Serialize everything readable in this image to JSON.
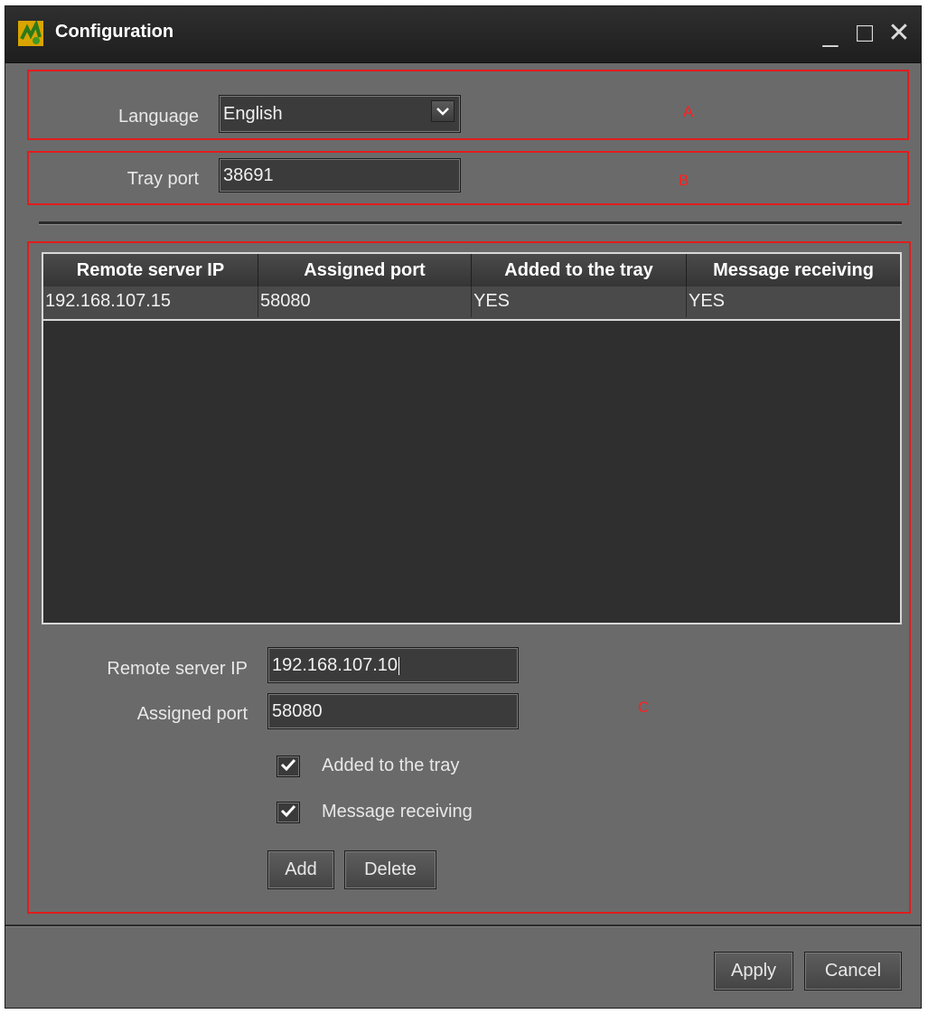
{
  "window": {
    "title": "Configuration",
    "controls": {
      "minimize": "_",
      "maximize": "□",
      "close": "✕"
    }
  },
  "section_a": {
    "zone_label": "A",
    "language_label": "Language",
    "language_value": "English",
    "dropdown_icon": "chevron-down-icon"
  },
  "section_b": {
    "zone_label": "B",
    "tray_port_label": "Tray port",
    "tray_port_value": "38691"
  },
  "section_c": {
    "zone_label": "C",
    "table": {
      "columns": [
        "Remote server IP",
        "Assigned port",
        "Added to the tray",
        "Message receiving"
      ],
      "rows": [
        [
          "192.168.107.15",
          "58080",
          "YES",
          "YES"
        ]
      ]
    },
    "form": {
      "remote_ip_label": "Remote server IP",
      "remote_ip_value": "192.168.107.10",
      "assigned_port_label": "Assigned port",
      "assigned_port_value": "58080",
      "added_to_tray_label": "Added to the tray",
      "added_to_tray_checked": true,
      "message_receiving_label": "Message receiving",
      "message_receiving_checked": true,
      "add_label": "Add",
      "delete_label": "Delete"
    }
  },
  "footer": {
    "apply_label": "Apply",
    "cancel_label": "Cancel"
  },
  "colors": {
    "zone_outline": "#e11c1c",
    "window_bg": "#6a6a6a",
    "table_bg": "#2f2f2f"
  }
}
